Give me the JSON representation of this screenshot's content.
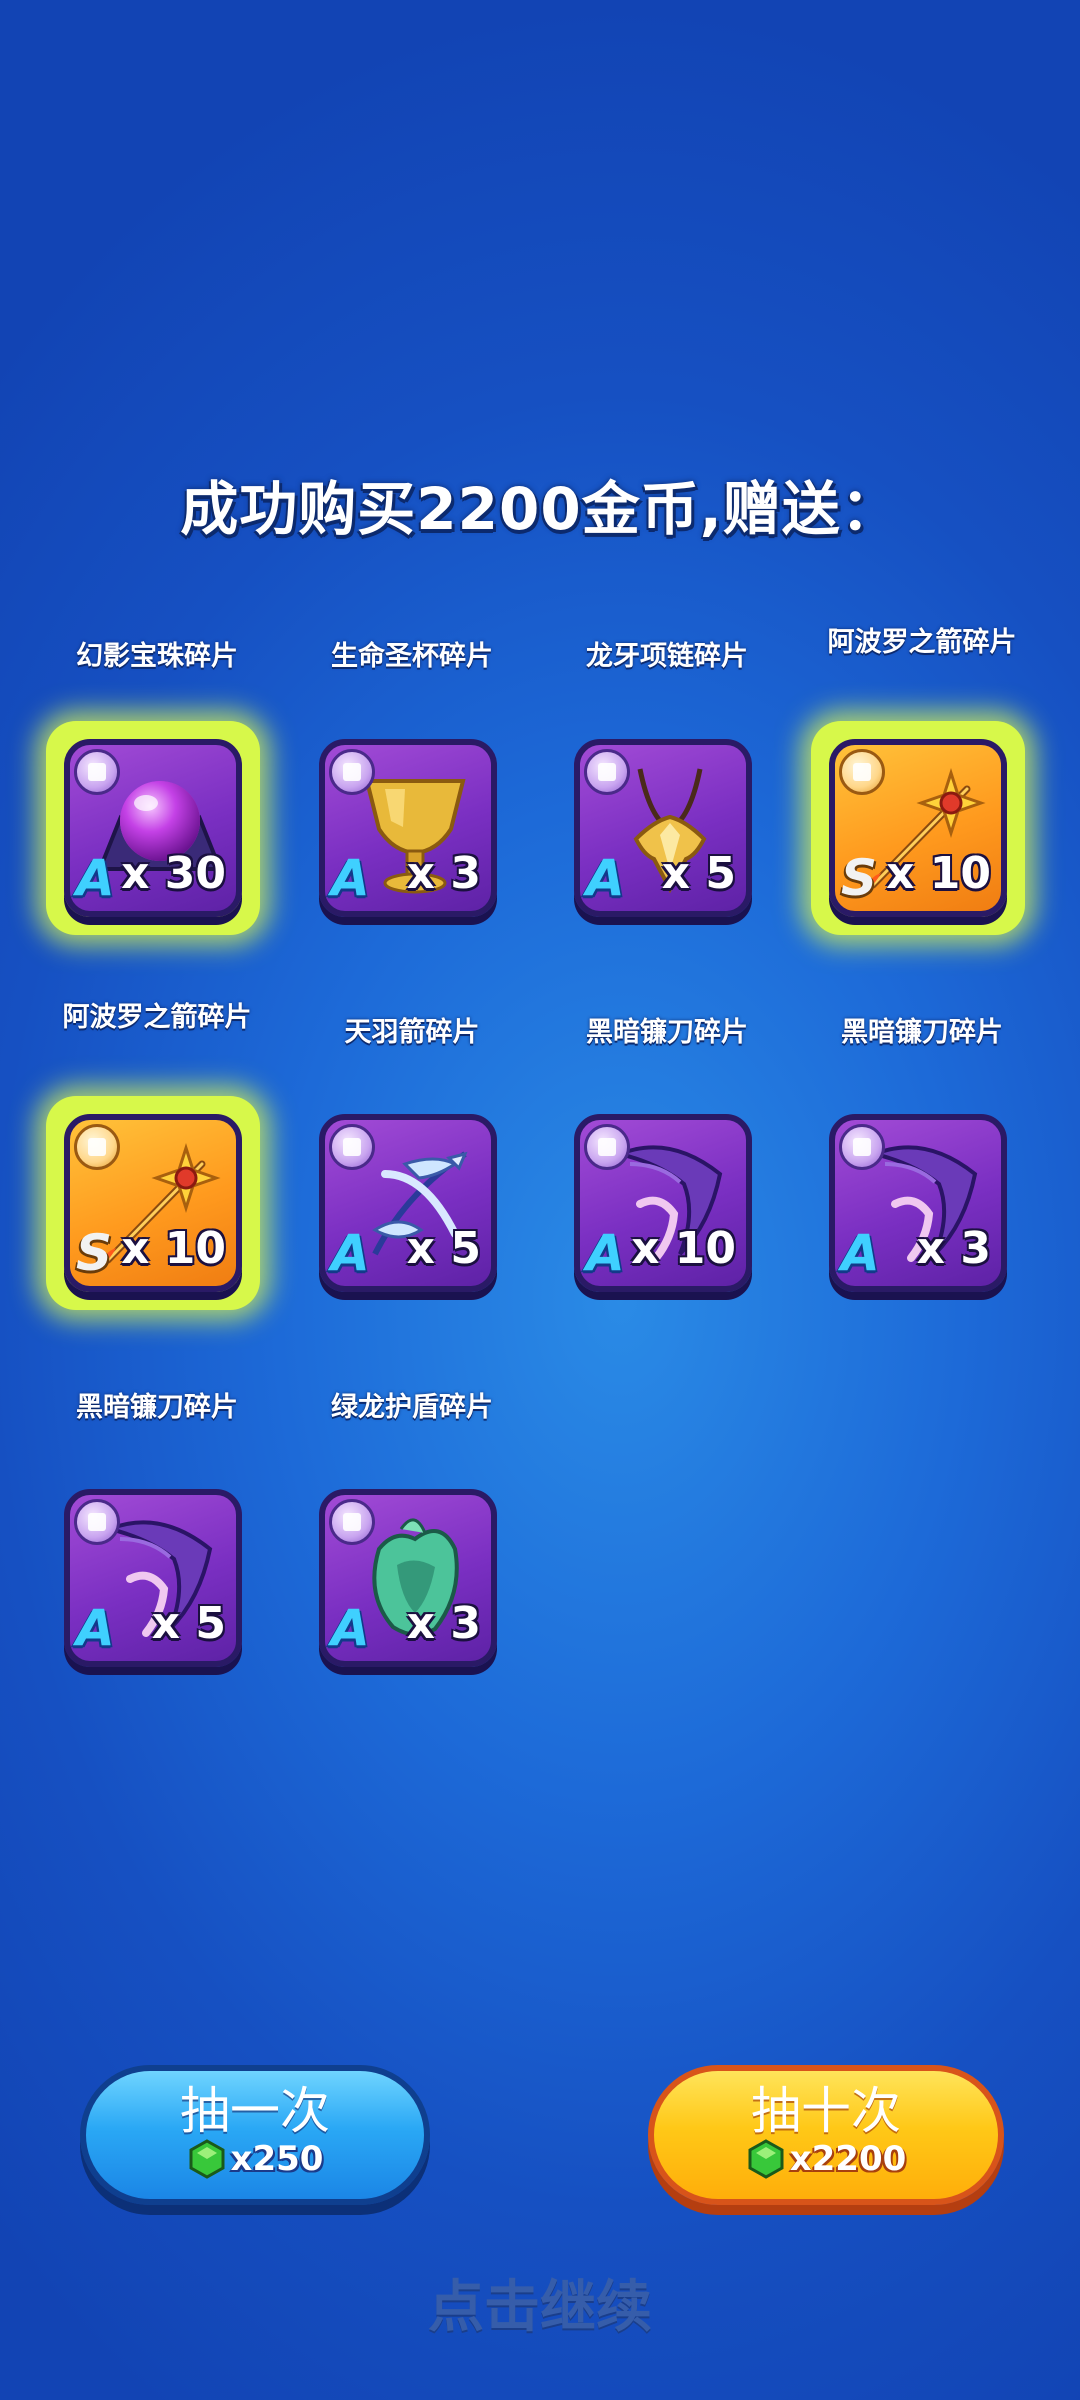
{
  "title": "成功购买2200金币,赠送：",
  "items": [
    {
      "name": "幻影宝珠碎片",
      "grade": "A",
      "qty": "x 30",
      "rarity": "purple",
      "glow": true,
      "icon": "purple-orb-icon"
    },
    {
      "name": "生命圣杯碎片",
      "grade": "A",
      "qty": "x 3",
      "rarity": "purple",
      "glow": false,
      "icon": "golden-chalice-icon"
    },
    {
      "name": "龙牙项链碎片",
      "grade": "A",
      "qty": "x 5",
      "rarity": "purple",
      "glow": false,
      "icon": "fang-necklace-icon"
    },
    {
      "name": "阿波罗之箭碎片",
      "grade": "S",
      "qty": "x 10",
      "rarity": "orange",
      "glow": true,
      "icon": "sun-arrow-icon"
    },
    {
      "name": "阿波罗之箭碎片",
      "grade": "S",
      "qty": "x 10",
      "rarity": "orange",
      "glow": true,
      "icon": "sun-arrow-icon"
    },
    {
      "name": "天羽箭碎片",
      "grade": "A",
      "qty": "x 5",
      "rarity": "purple",
      "glow": false,
      "icon": "feather-bow-icon"
    },
    {
      "name": "黑暗镰刀碎片",
      "grade": "A",
      "qty": "x 10",
      "rarity": "purple",
      "glow": false,
      "icon": "dark-scythe-icon"
    },
    {
      "name": "黑暗镰刀碎片",
      "grade": "A",
      "qty": "x 3",
      "rarity": "purple",
      "glow": false,
      "icon": "dark-scythe-icon"
    },
    {
      "name": "黑暗镰刀碎片",
      "grade": "A",
      "qty": "x 5",
      "rarity": "purple",
      "glow": false,
      "icon": "dark-scythe-icon"
    },
    {
      "name": "绿龙护盾碎片",
      "grade": "A",
      "qty": "x 3",
      "rarity": "purple",
      "glow": false,
      "icon": "green-dragon-shield-icon"
    }
  ],
  "buttons": {
    "draw_once": {
      "label": "抽一次",
      "cost": "x250",
      "icon": "green-gem-icon"
    },
    "draw_ten": {
      "label": "抽十次",
      "cost": "x2200",
      "icon": "green-gem-icon"
    }
  },
  "continue_text": "点击继续",
  "colors": {
    "background": "#1d6ad8",
    "card_purple": "#7a2fc2",
    "card_orange": "#ff9a1e",
    "glow": "#d7f84a",
    "button_blue": "#2aa8f5",
    "button_yellow": "#ffc817"
  }
}
